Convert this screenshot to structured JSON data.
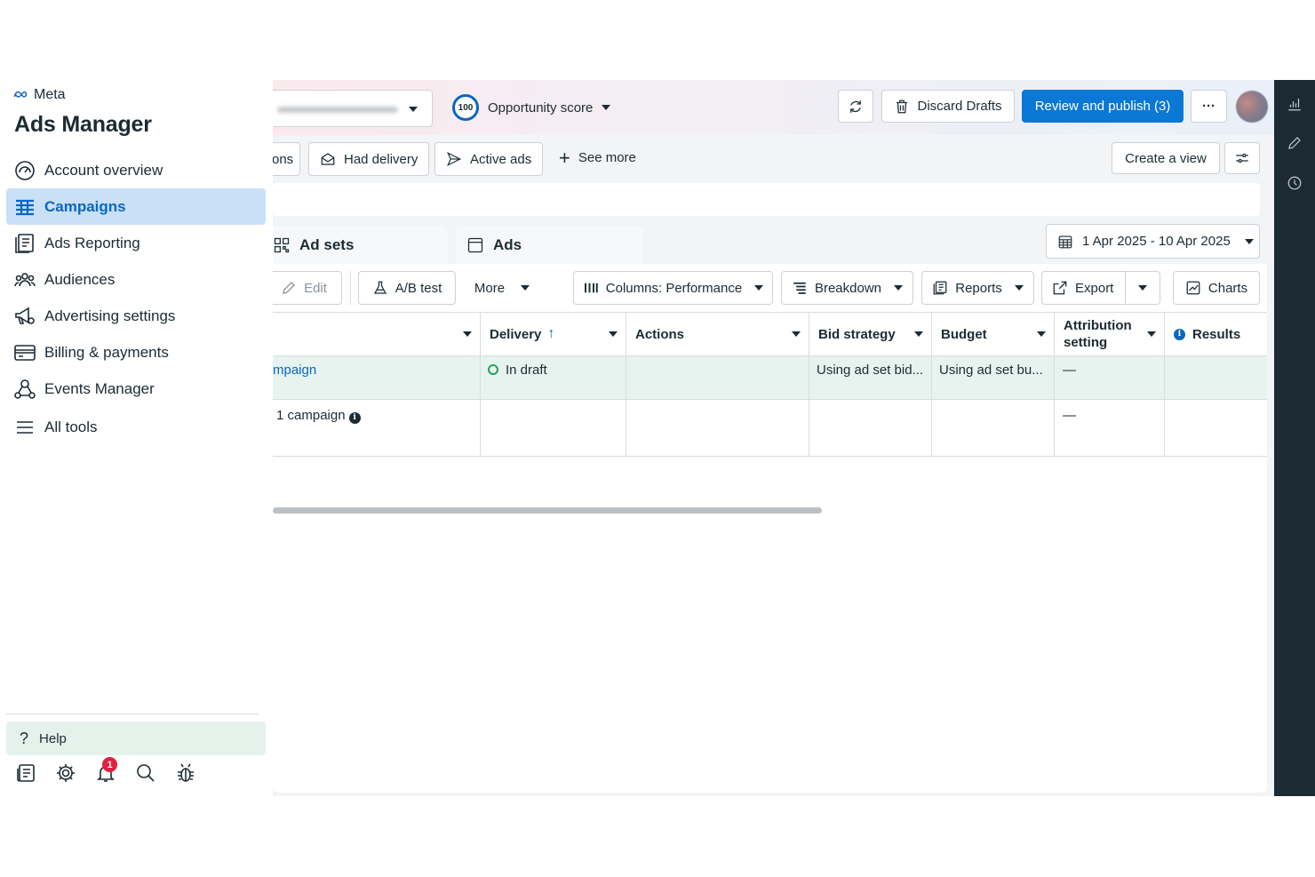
{
  "sidebar": {
    "brand": "Meta",
    "app_title": "Ads Manager",
    "items": [
      {
        "label": "Account overview",
        "icon": "gauge-icon"
      },
      {
        "label": "Campaigns",
        "icon": "table-grid-icon",
        "active": true
      },
      {
        "label": "Ads Reporting",
        "icon": "report-icon"
      },
      {
        "label": "Audiences",
        "icon": "people-icon"
      },
      {
        "label": "Advertising settings",
        "icon": "megaphone-gear-icon"
      },
      {
        "label": "Billing & payments",
        "icon": "card-icon"
      },
      {
        "label": "Events Manager",
        "icon": "network-icon"
      },
      {
        "label": "All tools",
        "icon": "menu-icon"
      }
    ],
    "help_label": "Help",
    "notifications_count": "1"
  },
  "topbar": {
    "opportunity_score_value": "100",
    "opportunity_score_label": "Opportunity score",
    "discard_label": "Discard Drafts",
    "publish_label": "Review and publish (3)",
    "more_label": "···"
  },
  "filters": {
    "partial_chip": "ons",
    "had_delivery": "Had delivery",
    "active_ads": "Active ads",
    "see_more": "See more",
    "create_view": "Create a view"
  },
  "tabs": {
    "adsets": "Ad sets",
    "ads": "Ads",
    "date_range": "1 Apr 2025 - 10 Apr 2025"
  },
  "toolbar": {
    "edit": "Edit",
    "ab_test": "A/B test",
    "more": "More",
    "columns": "Columns: Performance",
    "breakdown": "Breakdown",
    "reports": "Reports",
    "export": "Export",
    "charts": "Charts"
  },
  "table": {
    "headers": {
      "delivery": "Delivery",
      "delivery_sort": "↑",
      "actions": "Actions",
      "bid_strategy": "Bid strategy",
      "budget": "Budget",
      "attribution_line1": "Attribution",
      "attribution_line2": "setting",
      "results": "Results"
    },
    "rows": [
      {
        "name": "mpaign",
        "delivery": "In draft",
        "actions": "",
        "bid_strategy": "Using ad set bid...",
        "budget": "Using ad set bu...",
        "attribution": "—",
        "results": ""
      },
      {
        "name": "1 campaign",
        "delivery": "",
        "actions": "",
        "bid_strategy": "",
        "budget": "",
        "attribution": "—",
        "results": ""
      }
    ]
  },
  "colors": {
    "accent": "#0a66c2",
    "primary_button": "#0a78d4",
    "active_nav_bg": "#c9e0f7",
    "draft_row_bg": "#e6f3ee",
    "rail_bg": "#1c2b33"
  }
}
